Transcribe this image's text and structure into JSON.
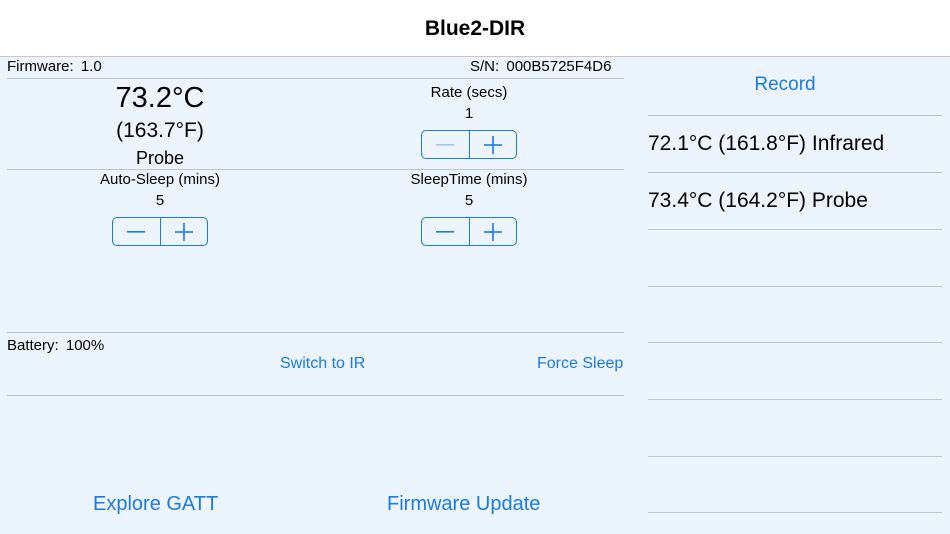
{
  "nav": {
    "title": "Blue2-DIR"
  },
  "device": {
    "firmware_label": "Firmware:",
    "firmware_value": "1.0",
    "sn_label": "S/N:",
    "sn_value": "000B5725F4D6",
    "battery_label": "Battery:",
    "battery_value": "100%"
  },
  "temperature": {
    "celsius": "73.2°C",
    "fahrenheit": "(163.7°F)",
    "source": "Probe"
  },
  "rate": {
    "label": "Rate (secs)",
    "value": "1",
    "minus_enabled": false
  },
  "auto_sleep": {
    "label": "Auto-Sleep (mins)",
    "value": "5"
  },
  "sleep_time": {
    "label": "SleepTime (mins)",
    "value": "5"
  },
  "actions": {
    "switch_ir": "Switch to IR",
    "force_sleep": "Force Sleep",
    "explore_gatt": "Explore GATT",
    "firmware_update": "Firmware Update"
  },
  "record": {
    "button_label": "Record",
    "readings": [
      "72.1°C (161.8°F) Infrared",
      "73.4°C (164.2°F) Probe"
    ]
  },
  "colors": {
    "accent": "#1a7ae6",
    "background": "#ecf5fe",
    "disabled": "#9ec6ef"
  }
}
